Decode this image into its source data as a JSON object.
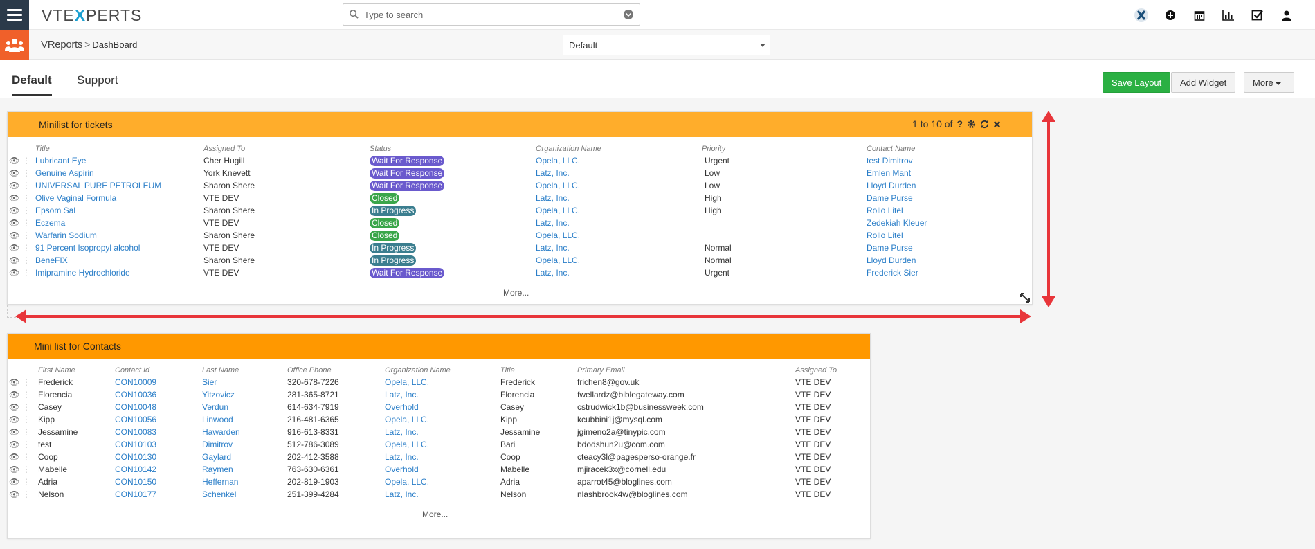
{
  "topbar": {
    "logo_pre": "VTE",
    "logo_x": "X",
    "logo_post": "PERTS",
    "search_placeholder": "Type to search",
    "icons": [
      "vtexperts-x-icon",
      "plus-circle-icon",
      "calendar-icon",
      "bar-chart-icon",
      "check-square-icon",
      "user-icon"
    ]
  },
  "breadcrumb": {
    "module": "VReports",
    "separator": ">",
    "page": "DashBoard"
  },
  "dashboard_select": {
    "value": "Default"
  },
  "tabs": [
    {
      "label": "Default"
    },
    {
      "label": "Support"
    }
  ],
  "toolbar": {
    "save_layout": "Save Layout",
    "add_widget": "Add Widget",
    "more": "More"
  },
  "tickets_widget": {
    "title": "Minilist for tickets",
    "pagination": "1 to 10 of",
    "total": "?",
    "columns": [
      "Title",
      "Assigned To",
      "Status",
      "Organization Name",
      "Priority",
      "Contact Name"
    ],
    "rows": [
      {
        "title": "Lubricant Eye",
        "assigned": "Cher Hugill",
        "status": "Wait For Response",
        "org": "Opela, LLC.",
        "priority": "Urgent",
        "contact": "test Dimitrov"
      },
      {
        "title": "Genuine Aspirin",
        "assigned": "York Knevett",
        "status": "Wait For Response",
        "org": "Latz, Inc.",
        "priority": "Low",
        "contact": "Emlen Mant"
      },
      {
        "title": "UNIVERSAL PURE PETROLEUM",
        "assigned": "Sharon Shere",
        "status": "Wait For Response",
        "org": "Opela, LLC.",
        "priority": "Low",
        "contact": "Lloyd Durden"
      },
      {
        "title": "Olive Vaginal Formula",
        "assigned": "VTE DEV",
        "status": "Closed",
        "org": "Latz, Inc.",
        "priority": "High",
        "contact": "Dame Purse"
      },
      {
        "title": "Epsom Sal",
        "assigned": "Sharon Shere",
        "status": "In Progress",
        "org": "Opela, LLC.",
        "priority": "High",
        "contact": "Rollo Litel"
      },
      {
        "title": "Eczema",
        "assigned": "VTE DEV",
        "status": "Closed",
        "org": "Latz, Inc.",
        "priority": "",
        "contact": "Zedekiah Kleuer"
      },
      {
        "title": "Warfarin Sodium",
        "assigned": "Sharon Shere",
        "status": "Closed",
        "org": "Opela, LLC.",
        "priority": "",
        "contact": "Rollo Litel"
      },
      {
        "title": "91 Percent Isopropyl alcohol",
        "assigned": "VTE DEV",
        "status": "In Progress",
        "org": "Latz, Inc.",
        "priority": "Normal",
        "contact": "Dame Purse"
      },
      {
        "title": "BeneFIX",
        "assigned": "Sharon Shere",
        "status": "In Progress",
        "org": "Opela, LLC.",
        "priority": "Normal",
        "contact": "Lloyd Durden"
      },
      {
        "title": "Imipramine Hydrochloride",
        "assigned": "VTE DEV",
        "status": "Wait For Response",
        "org": "Latz, Inc.",
        "priority": "Urgent",
        "contact": "Frederick Sier"
      }
    ],
    "more": "More..."
  },
  "contacts_widget": {
    "title": "Mini list for Contacts",
    "columns": [
      "First Name",
      "Contact Id",
      "Last Name",
      "Office Phone",
      "Organization Name",
      "Title",
      "Primary Email",
      "Assigned To"
    ],
    "rows": [
      {
        "first": "Frederick",
        "id": "CON10009",
        "last": "Sier",
        "phone": "320-678-7226",
        "org": "Opela, LLC.",
        "title": "Frederick",
        "email": "frichen8@gov.uk",
        "assigned": "VTE DEV"
      },
      {
        "first": "Florencia",
        "id": "CON10036",
        "last": "Yitzovicz",
        "phone": "281-365-8721",
        "org": "Latz, Inc.",
        "title": "Florencia",
        "email": "fwellardz@biblegateway.com",
        "assigned": "VTE DEV"
      },
      {
        "first": "Casey",
        "id": "CON10048",
        "last": "Verdun",
        "phone": "614-634-7919",
        "org": "Overhold",
        "title": "Casey",
        "email": "cstrudwick1b@businessweek.com",
        "assigned": "VTE DEV"
      },
      {
        "first": "Kipp",
        "id": "CON10056",
        "last": "Linwood",
        "phone": "216-481-6365",
        "org": "Opela, LLC.",
        "title": "Kipp",
        "email": "kcubbini1j@mysql.com",
        "assigned": "VTE DEV"
      },
      {
        "first": "Jessamine",
        "id": "CON10083",
        "last": "Hawarden",
        "phone": "916-613-8331",
        "org": "Latz, Inc.",
        "title": "Jessamine",
        "email": "jgimeno2a@tinypic.com",
        "assigned": "VTE DEV"
      },
      {
        "first": "test",
        "id": "CON10103",
        "last": "Dimitrov",
        "phone": "512-786-3089",
        "org": "Opela, LLC.",
        "title": "Bari",
        "email": "bdodshun2u@com.com",
        "assigned": "VTE DEV"
      },
      {
        "first": "Coop",
        "id": "CON10130",
        "last": "Gaylard",
        "phone": "202-412-3588",
        "org": "Latz, Inc.",
        "title": "Coop",
        "email": "cteacy3l@pagesperso-orange.fr",
        "assigned": "VTE DEV"
      },
      {
        "first": "Mabelle",
        "id": "CON10142",
        "last": "Raymen",
        "phone": "763-630-6361",
        "org": "Overhold",
        "title": "Mabelle",
        "email": "mjiracek3x@cornell.edu",
        "assigned": "VTE DEV"
      },
      {
        "first": "Adria",
        "id": "CON10150",
        "last": "Heffernan",
        "phone": "202-819-1903",
        "org": "Opela, LLC.",
        "title": "Adria",
        "email": "aparrot45@bloglines.com",
        "assigned": "VTE DEV"
      },
      {
        "first": "Nelson",
        "id": "CON10177",
        "last": "Schenkel",
        "phone": "251-399-4284",
        "org": "Latz, Inc.",
        "title": "Nelson",
        "email": "nlashbrook4w@bloglines.com",
        "assigned": "VTE DEV"
      }
    ],
    "more": "More..."
  },
  "colors": {
    "accent_orange": "#ffad2b",
    "widget2_orange": "#ff9800",
    "link": "#2a7ec8",
    "save_green": "#2bb043",
    "resize_arrow": "#e8353a"
  }
}
